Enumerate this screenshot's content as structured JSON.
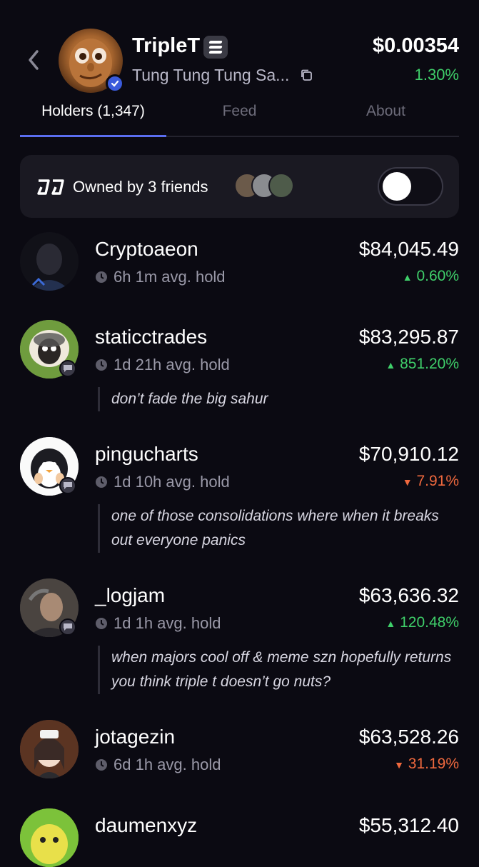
{
  "header": {
    "token_name": "TripleT",
    "token_full_name": "Tung Tung Tung Sa...",
    "price": "$0.00354",
    "change": "1.30%"
  },
  "tabs": [
    {
      "label": "Holders (1,347)",
      "active": true
    },
    {
      "label": "Feed",
      "active": false
    },
    {
      "label": "About",
      "active": false
    }
  ],
  "friends": {
    "text": "Owned by 3 friends",
    "toggle_on": false
  },
  "holders": [
    {
      "name": "Cryptoaeon",
      "hold": "6h 1m avg. hold",
      "value": "$84,045.49",
      "change": "0.60%",
      "direction": "up",
      "quote": "",
      "has_chat": false
    },
    {
      "name": "staticctrades",
      "hold": "1d 21h avg. hold",
      "value": "$83,295.87",
      "change": "851.20%",
      "direction": "up",
      "quote": "don’t fade the big sahur",
      "has_chat": true
    },
    {
      "name": "pingucharts",
      "hold": "1d 10h avg. hold",
      "value": "$70,910.12",
      "change": "7.91%",
      "direction": "down",
      "quote": "one of those consolidations where when it breaks out everyone panics",
      "has_chat": true
    },
    {
      "name": "_logjam",
      "hold": "1d 1h avg. hold",
      "value": "$63,636.32",
      "change": "120.48%",
      "direction": "up",
      "quote": "when majors cool off & meme szn hopefully returns you think triple t doesn’t go nuts?",
      "has_chat": true
    },
    {
      "name": "jotagezin",
      "hold": "6d 1h avg. hold",
      "value": "$63,528.26",
      "change": "31.19%",
      "direction": "down",
      "quote": "",
      "has_chat": false
    },
    {
      "name": "daumenxyz",
      "hold": "",
      "value": "$55,312.40",
      "change": "",
      "direction": "up",
      "quote": "",
      "has_chat": false
    }
  ],
  "colors": {
    "background": "#0b0a12",
    "up": "#3fcf6a",
    "down": "#f0693e",
    "accent": "#5b6ef0"
  }
}
